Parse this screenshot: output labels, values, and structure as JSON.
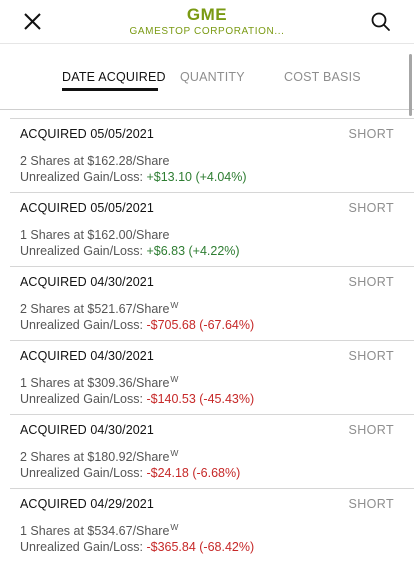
{
  "header": {
    "ticker": "GME",
    "company": "GAMESTOP CORPORATION...",
    "close_icon": "close-icon",
    "search_icon": "search-icon",
    "accent_color": "#7a9a13"
  },
  "tabs": [
    {
      "label": "DATE ACQUIRED",
      "active": true
    },
    {
      "label": "QUANTITY",
      "active": false
    },
    {
      "label": "COST BASIS",
      "active": false
    }
  ],
  "lots": [
    {
      "date": "ACQUIRED 05/05/2021",
      "term": "SHORT",
      "shares": "2 Shares at $162.28/Share",
      "wash": "",
      "gain_label": "Unrealized Gain/Loss: ",
      "gain": "+$13.10 (+4.04%)",
      "gain_color": "#2e7d32"
    },
    {
      "date": "ACQUIRED 05/05/2021",
      "term": "SHORT",
      "shares": "1 Shares at $162.00/Share",
      "wash": "",
      "gain_label": "Unrealized Gain/Loss: ",
      "gain": "+$6.83 (+4.22%)",
      "gain_color": "#2e7d32"
    },
    {
      "date": "ACQUIRED 04/30/2021",
      "term": "SHORT",
      "shares": "2 Shares at $521.67/Share",
      "wash": "W",
      "gain_label": "Unrealized Gain/Loss: ",
      "gain": "-$705.68 (-67.64%)",
      "gain_color": "#c62828"
    },
    {
      "date": "ACQUIRED 04/30/2021",
      "term": "SHORT",
      "shares": "1 Shares at $309.36/Share",
      "wash": "W",
      "gain_label": "Unrealized Gain/Loss: ",
      "gain": "-$140.53 (-45.43%)",
      "gain_color": "#c62828"
    },
    {
      "date": "ACQUIRED 04/30/2021",
      "term": "SHORT",
      "shares": "2 Shares at $180.92/Share",
      "wash": "W",
      "gain_label": "Unrealized Gain/Loss: ",
      "gain": "-$24.18 (-6.68%)",
      "gain_color": "#c62828"
    },
    {
      "date": "ACQUIRED 04/29/2021",
      "term": "SHORT",
      "shares": "1 Shares at $534.67/Share",
      "wash": "W",
      "gain_label": "Unrealized Gain/Loss: ",
      "gain": "-$365.84 (-68.42%)",
      "gain_color": "#c62828"
    }
  ]
}
